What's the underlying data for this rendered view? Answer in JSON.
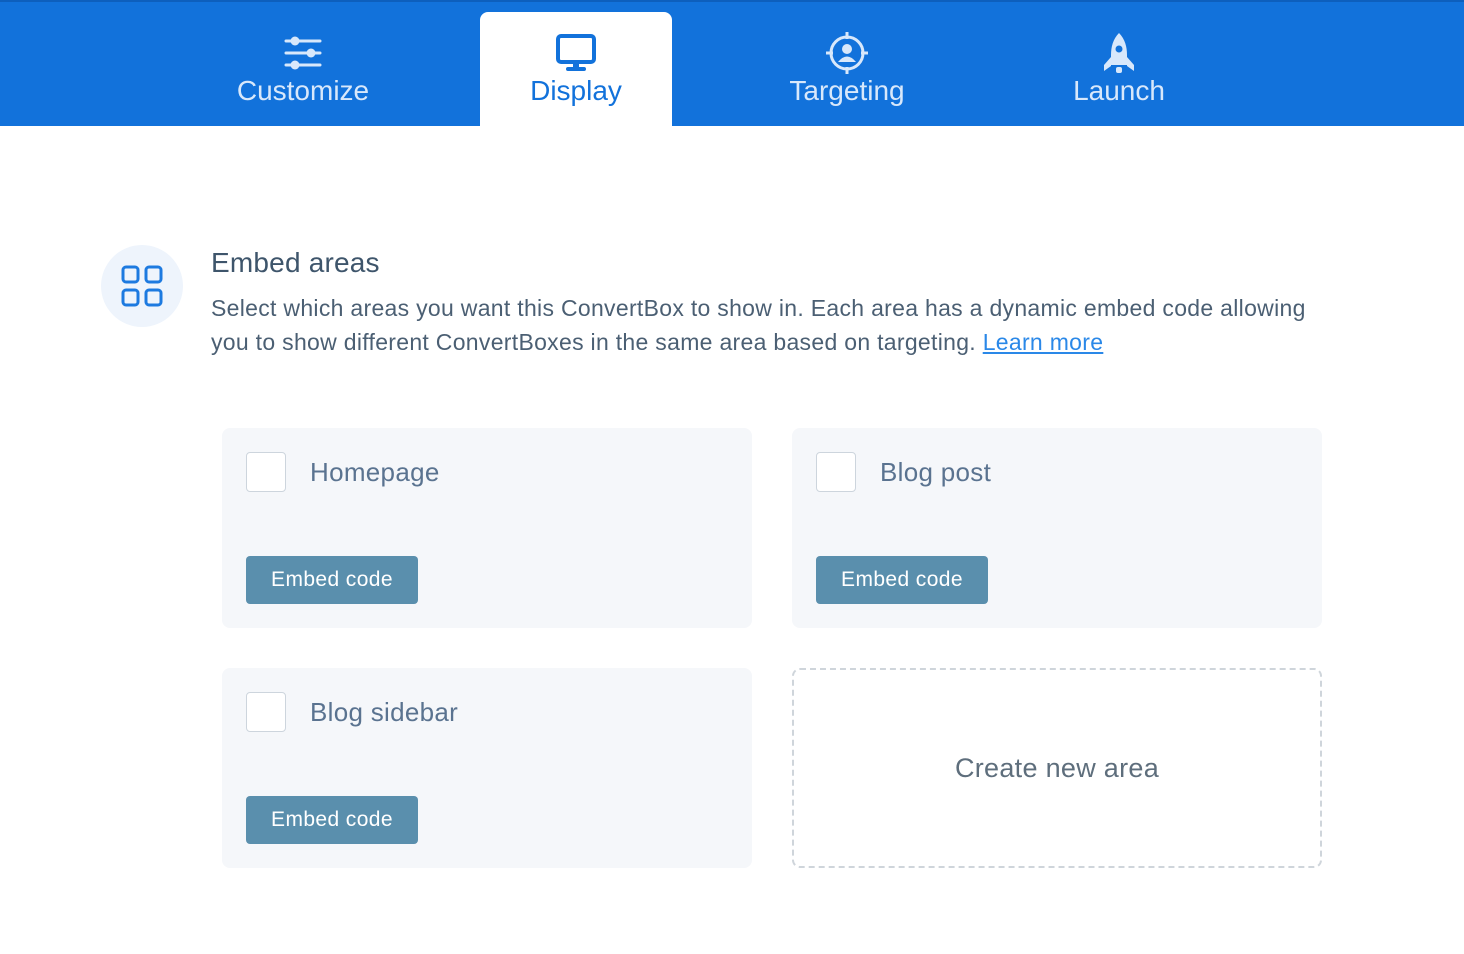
{
  "tabs": [
    {
      "label": "Customize",
      "icon": "sliders-icon"
    },
    {
      "label": "Display",
      "icon": "monitor-icon",
      "active": true
    },
    {
      "label": "Targeting",
      "icon": "target-user-icon"
    },
    {
      "label": "Launch",
      "icon": "rocket-icon"
    }
  ],
  "section": {
    "icon": "grid-icon",
    "title": "Embed areas",
    "description": "Select which areas you want this ConvertBox to show in. Each area has a dynamic embed code allowing you to show different ConvertBoxes in the same area based on targeting.",
    "learn_more": "Learn more"
  },
  "areas": [
    {
      "name": "Homepage",
      "checked": false,
      "button": "Embed code"
    },
    {
      "name": "Blog post",
      "checked": false,
      "button": "Embed code"
    },
    {
      "name": "Blog sidebar",
      "checked": false,
      "button": "Embed code"
    }
  ],
  "create_area": {
    "label": "Create new area"
  },
  "colors": {
    "topbar": "#1272db",
    "accent": "#1272db",
    "embed_button": "#5a8fad",
    "card_bg": "#f5f7fa",
    "link": "#2a88e8"
  }
}
